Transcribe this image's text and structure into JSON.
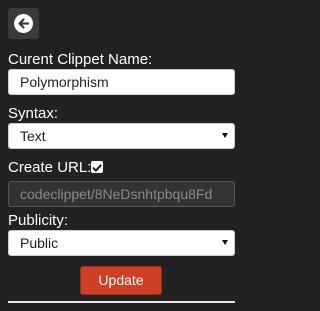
{
  "back": {
    "icon": "arrow-left-circle-icon"
  },
  "name_field": {
    "label": "Curent Clippet Name:",
    "value": "Polymorphism"
  },
  "syntax": {
    "label": "Syntax:",
    "selected": "Text"
  },
  "create_url": {
    "label": "Create URL:",
    "checked": true,
    "placeholder": "codeclippet/8NeDsnhtpbqu8Fd"
  },
  "publicity": {
    "label": "Publicity:",
    "selected": "Public"
  },
  "update_button": {
    "label": "Update"
  },
  "colors": {
    "background": "#222222",
    "button_accent": "#cf3f23"
  }
}
